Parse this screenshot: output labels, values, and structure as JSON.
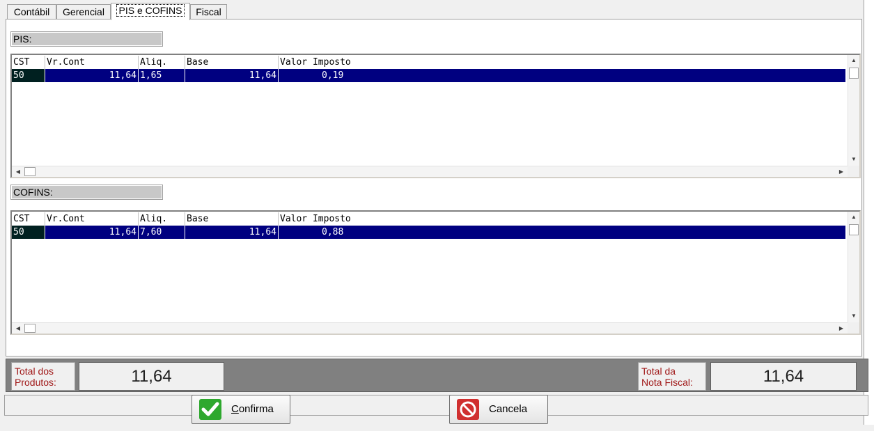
{
  "tabs": [
    {
      "label": "Contábil"
    },
    {
      "label": "Gerencial"
    },
    {
      "label": "PIS e COFINS",
      "active": true
    },
    {
      "label": "Fiscal"
    }
  ],
  "pis": {
    "label": "PIS:",
    "columns": [
      "CST",
      "Vr.Cont",
      "Aliq.",
      "Base",
      "Valor Imposto"
    ],
    "rows": [
      {
        "cst": "50",
        "vr_cont": "11,64",
        "aliq": "1,65",
        "base": "11,64",
        "valor_imposto": "0,19"
      }
    ]
  },
  "cofins": {
    "label": "COFINS:",
    "columns": [
      "CST",
      "Vr.Cont",
      "Aliq.",
      "Base",
      "Valor Imposto"
    ],
    "rows": [
      {
        "cst": "50",
        "vr_cont": "11,64",
        "aliq": "7,60",
        "base": "11,64",
        "valor_imposto": "0,88"
      }
    ]
  },
  "totals": {
    "produtos_label_line1": "Total dos",
    "produtos_label_line2": "Produtos:",
    "produtos_value": "11,64",
    "nota_label_line1": "Total da",
    "nota_label_line2": "Nota Fiscal:",
    "nota_value": "11,64"
  },
  "buttons": {
    "confirma_mnemonic": "C",
    "confirma_rest": "onfirma",
    "cancela": "Cancela"
  },
  "colors": {
    "selection": "#000080",
    "label_red": "#a01818",
    "confirm_green": "#2ea82e",
    "cancel_red": "#d03030"
  },
  "icons": {
    "confirma": "checkmark-icon",
    "cancela": "no-entry-icon"
  }
}
